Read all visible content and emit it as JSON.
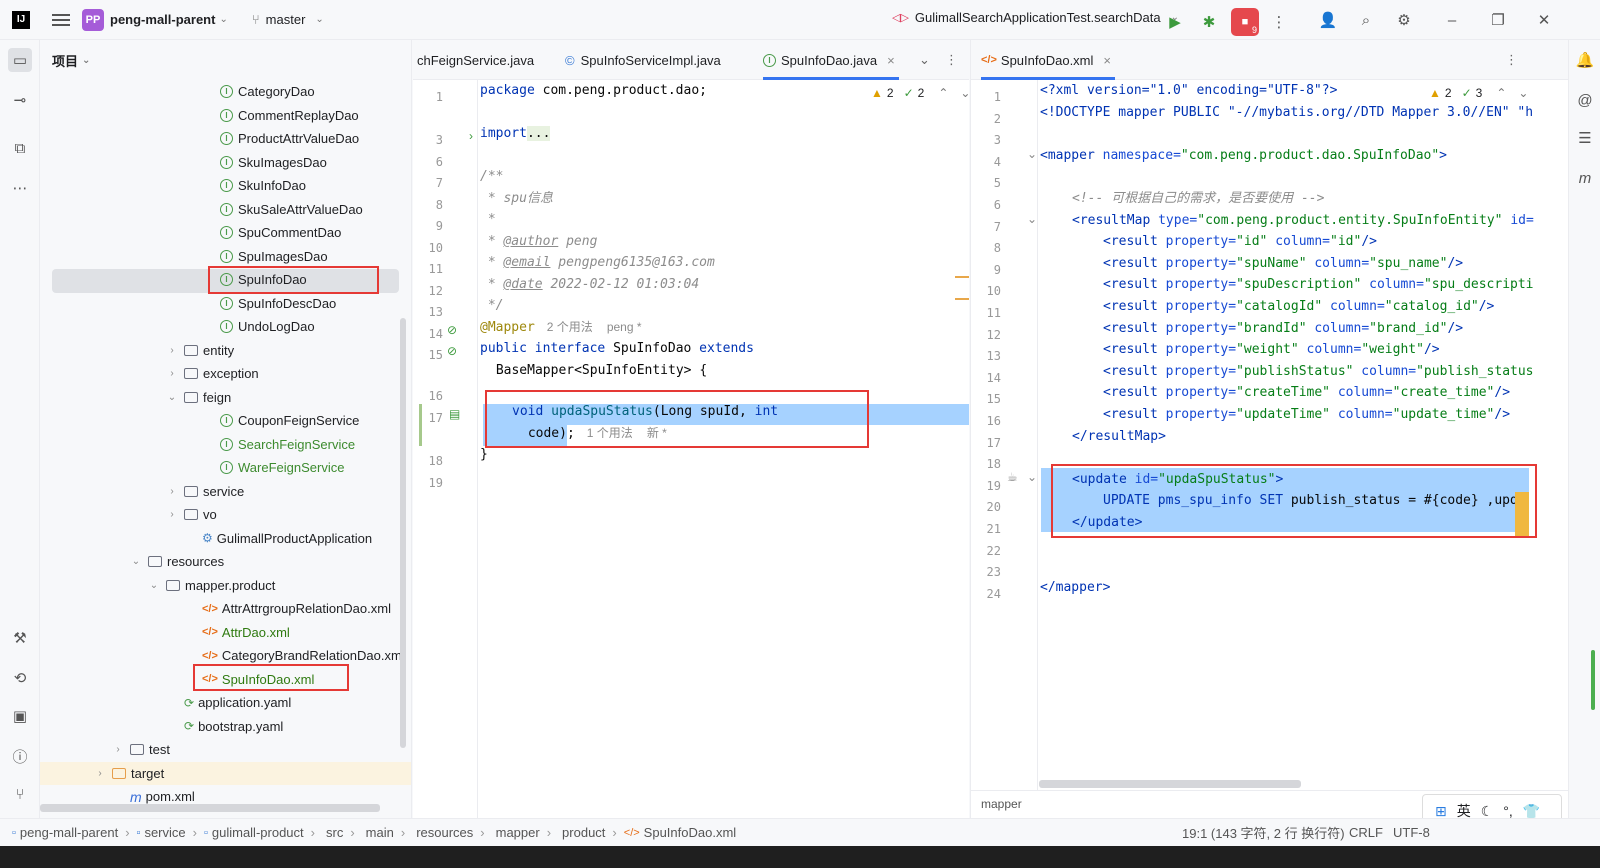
{
  "titlebar": {
    "project_badge": "PP",
    "project_name": "peng-mall-parent",
    "branch": "master",
    "run_config": "GulimallSearchApplicationTest.searchData",
    "notif_count": "9"
  },
  "project_panel": {
    "title": "项目",
    "items": [
      {
        "label": "CategoryDao",
        "type": "iface"
      },
      {
        "label": "CommentReplayDao",
        "type": "iface"
      },
      {
        "label": "ProductAttrValueDao",
        "type": "iface"
      },
      {
        "label": "SkuImagesDao",
        "type": "iface"
      },
      {
        "label": "SkuInfoDao",
        "type": "iface"
      },
      {
        "label": "SkuSaleAttrValueDao",
        "type": "iface"
      },
      {
        "label": "SpuCommentDao",
        "type": "iface"
      },
      {
        "label": "SpuImagesDao",
        "type": "iface"
      },
      {
        "label": "SpuInfoDao",
        "type": "iface"
      },
      {
        "label": "SpuInfoDescDao",
        "type": "iface"
      },
      {
        "label": "UndoLogDao",
        "type": "iface"
      },
      {
        "label": "entity",
        "type": "folder"
      },
      {
        "label": "exception",
        "type": "folder"
      },
      {
        "label": "feign",
        "type": "folder"
      },
      {
        "label": "CouponFeignService",
        "type": "iface"
      },
      {
        "label": "SearchFeignService",
        "type": "iface"
      },
      {
        "label": "WareFeignService",
        "type": "iface"
      },
      {
        "label": "service",
        "type": "folder"
      },
      {
        "label": "vo",
        "type": "folder"
      },
      {
        "label": "GulimallProductApplication",
        "type": "spring"
      },
      {
        "label": "resources",
        "type": "folder"
      },
      {
        "label": "mapper.product",
        "type": "folder"
      },
      {
        "label": "AttrAttrgroupRelationDao.xml",
        "type": "xml"
      },
      {
        "label": "AttrDao.xml",
        "type": "xml"
      },
      {
        "label": "CategoryBrandRelationDao.xml",
        "type": "xml"
      },
      {
        "label": "SpuInfoDao.xml",
        "type": "xml"
      },
      {
        "label": "application.yaml",
        "type": "yaml"
      },
      {
        "label": "bootstrap.yaml",
        "type": "yaml"
      },
      {
        "label": "test",
        "type": "folder"
      },
      {
        "label": "target",
        "type": "folder"
      },
      {
        "label": "pom.xml",
        "type": "maven"
      }
    ]
  },
  "left_editor": {
    "tabs": [
      "chFeignService.java",
      "SpuInfoServiceImpl.java",
      "SpuInfoDao.java"
    ],
    "inspection": {
      "warnings": "2",
      "ok": "2"
    },
    "lines": [
      "1",
      "3",
      "6",
      "7",
      "8",
      "9",
      "10",
      "11",
      "12",
      "13",
      "14",
      "15",
      "16",
      "17",
      "18",
      "19"
    ],
    "code": {
      "l1a": "package",
      "l1b": " com.peng.product.dao;",
      "l3a": "import",
      "l3b": "...",
      "l7": "/**",
      "l8": " * spu信息",
      "l9": " *",
      "l10a": " * ",
      "l10b": "@author",
      "l10c": " peng",
      "l11a": " * ",
      "l11b": "@email",
      "l11c": " pengpeng6135@163.com",
      "l12a": " * ",
      "l12b": "@date",
      "l12c": " 2022-02-12 01:03:04",
      "l13": " */",
      "l14a": "@Mapper",
      "l14b": "2 个用法",
      "l14c": "peng *",
      "l15a": "public",
      "l15b": " ",
      "l15c": "interface",
      "l15d": " SpuInfoDao ",
      "l15e": "extends",
      "l15f": " BaseMapper<SpuInfoEntity> {",
      "l17a": "void",
      "l17b": " updaSpuStatus",
      "l17c": "(Long spuId, ",
      "l17d": "int",
      "l17e": " code);",
      "l17f": "1 个用法",
      "l17g": "新 *",
      "l18": "}"
    }
  },
  "right_editor": {
    "tab": "SpuInfoDao.xml",
    "inspection": {
      "warnings": "2",
      "ok": "3"
    },
    "lines": [
      "1",
      "2",
      "3",
      "4",
      "5",
      "6",
      "7",
      "8",
      "9",
      "10",
      "11",
      "12",
      "13",
      "14",
      "15",
      "16",
      "17",
      "18",
      "19",
      "20",
      "21",
      "22",
      "23",
      "24"
    ],
    "code": {
      "l1": "<?xml version=\"1.0\" encoding=\"UTF-8\"?>",
      "l2": "<!DOCTYPE mapper PUBLIC \"-//mybatis.org//DTD Mapper 3.0//EN\" \"h",
      "l4a": "<mapper",
      "l4b": " namespace=",
      "l4c": "\"com.peng.product.dao.SpuInfoDao\"",
      "l4d": ">",
      "l6": "<!-- 可根据自己的需求，是否要使用 -->",
      "l7a": "<resultMap",
      "l7b": " type=",
      "l7c": "\"com.peng.product.entity.SpuInfoEntity\"",
      "l7d": " id=",
      "results": [
        [
          "\"id\"",
          "\"id\"",
          "/>"
        ],
        [
          "\"spuName\"",
          "\"spu_name\"",
          "/>"
        ],
        [
          "\"spuDescription\"",
          "\"spu_descripti",
          ""
        ],
        [
          "\"catalogId\"",
          "\"catalog_id\"",
          "/>"
        ],
        [
          "\"brandId\"",
          "\"brand_id\"",
          "/>"
        ],
        [
          "\"weight\"",
          "\"weight\"",
          "/>"
        ],
        [
          "\"publishStatus\"",
          "\"publish_status",
          ""
        ],
        [
          "\"createTime\"",
          "\"create_time\"",
          "/>"
        ],
        [
          "\"updateTime\"",
          "\"update_time\"",
          "/>"
        ]
      ],
      "result_tag": "<result",
      "result_prop": " property=",
      "result_col": " column=",
      "l17": "</resultMap>",
      "l19a": "<update",
      "l19b": " id=",
      "l19c": "\"updaSpuStatus\"",
      "l19d": ">",
      "l20a": "UPDATE pms_spu_info ",
      "l20b": "SET",
      "l20c": " publish_status = #{code} ,upd",
      "l21": "</update>",
      "l24": "</mapper>"
    },
    "footer": "mapper"
  },
  "status": {
    "breadcrumb": [
      "peng-mall-parent",
      "service",
      "gulimall-product",
      "src",
      "main",
      "resources",
      "mapper",
      "product",
      "SpuInfoDao.xml"
    ],
    "position": "19:1 (143 字符, 2 行 换行符)",
    "line_sep": "CRLF",
    "encoding": "UTF-8"
  },
  "ime": {
    "label": "英"
  }
}
